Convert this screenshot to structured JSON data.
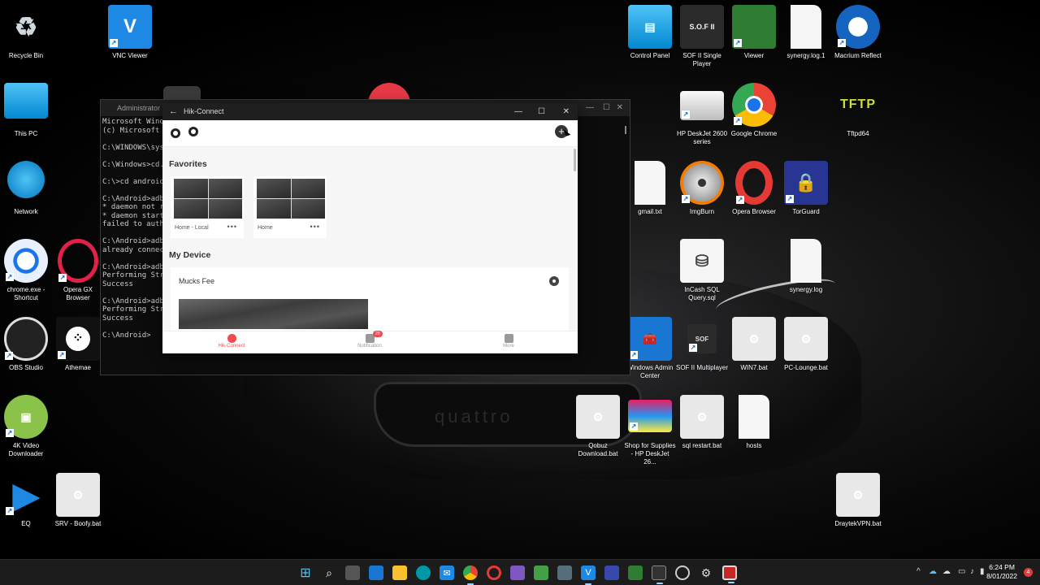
{
  "desktop_icons": [
    {
      "label": "Recycle Bin",
      "icon": "recycle-bin-icon",
      "color": "#cfd8dc"
    },
    {
      "label": "VNC Viewer",
      "icon": "vnc-icon",
      "color": "#1e88e5",
      "text": "V"
    },
    {
      "label": "This PC",
      "icon": "monitor-icon",
      "color": "#29b6f6"
    },
    {
      "label": "Network",
      "icon": "network-icon",
      "color": "#29b6f6"
    },
    {
      "label": "chrome.exe - Shortcut",
      "icon": "chrome-icon",
      "color": "#1a73e8"
    },
    {
      "label": "Opera GX Browser",
      "icon": "opera-gx-icon",
      "color": "#111"
    },
    {
      "label": "OBS Studio",
      "icon": "obs-icon",
      "color": "#222"
    },
    {
      "label": "Athemae",
      "icon": "tidal-icon",
      "color": "#111"
    },
    {
      "label": "4K Video Downloader",
      "icon": "downloader-icon",
      "color": "#8bc34a"
    },
    {
      "label": "EQ",
      "icon": "play-icon",
      "color": "#1e88e5"
    },
    {
      "label": "SRV - Boofy.bat",
      "icon": "batch-file-icon"
    },
    {
      "label": "Control Panel",
      "icon": "control-panel-icon",
      "color": "#29b6f6"
    },
    {
      "label": "SOF II Single Player",
      "icon": "sof-icon",
      "color": "#333",
      "text": "S.O.F II"
    },
    {
      "label": "Viewer",
      "icon": "viewer-icon",
      "color": "#2e7d32"
    },
    {
      "label": "synergy.log.1",
      "icon": "text-file-icon"
    },
    {
      "label": "Macrium Reflect",
      "icon": "macrium-icon",
      "color": "#1565c0"
    },
    {
      "label": "HP DeskJet 2600 series",
      "icon": "printer-icon",
      "color": "#e0e0e0"
    },
    {
      "label": "Google Chrome",
      "icon": "chrome-icon",
      "color": "#1a73e8"
    },
    {
      "label": "Tftpd64",
      "icon": "tftp-icon",
      "color": "#9e9d24",
      "text": "TFTP"
    },
    {
      "label": "gmail.txt",
      "icon": "text-file-icon"
    },
    {
      "label": "ImgBurn",
      "icon": "imgburn-icon",
      "color": "#bdbdbd"
    },
    {
      "label": "Opera Browser",
      "icon": "opera-icon",
      "color": "#e53935"
    },
    {
      "label": "TorGuard",
      "icon": "torguard-icon",
      "color": "#283593"
    },
    {
      "label": "InCash SQL Query.sql",
      "icon": "sql-file-icon",
      "color": "#f5f5f5"
    },
    {
      "label": "synergy.log",
      "icon": "text-file-icon"
    },
    {
      "label": "Windows Admin Center",
      "icon": "admin-center-icon",
      "color": "#1976d2"
    },
    {
      "label": "SOF II Multiplayer",
      "icon": "sof-icon",
      "color": "#333"
    },
    {
      "label": "WIN7.bat",
      "icon": "batch-file-icon"
    },
    {
      "label": "PC-Lounge.bat",
      "icon": "batch-file-icon"
    },
    {
      "label": "Qobuz Download.bat",
      "icon": "batch-file-icon"
    },
    {
      "label": "Shop for Supplies - HP DeskJet 26...",
      "icon": "printer-supplies-icon",
      "color": "#fafafa"
    },
    {
      "label": "sql restart.bat",
      "icon": "batch-file-icon"
    },
    {
      "label": "hosts",
      "icon": "text-file-icon"
    },
    {
      "label": "DraytekVPN.bat",
      "icon": "batch-file-icon"
    }
  ],
  "cmd": {
    "title": "Administrator",
    "lines": "Microsoft Wind\n(c) Microsoft \n\nC:\\WINDOWS\\sys\n\nC:\\Windows>cd.\n\nC:\\>cd android\n\nC:\\Android>adb\n* daemon not r\n* daemon start\nfailed to auth\n\nC:\\Android>adb\nalready connec\n\nC:\\Android>adb\nPerforming Str\nSuccess\n\nC:\\Android>adb\nPerforming Str\nSuccess\n\nC:\\Android>"
  },
  "hik": {
    "title": "Hik-Connect",
    "favorites_title": "Favorites",
    "favorites": [
      {
        "name": "Home - Local",
        "more": "•••"
      },
      {
        "name": "Home",
        "more": "•••"
      }
    ],
    "my_device_title": "My Device",
    "device_name": "Mucks Fee",
    "nav": [
      {
        "label": "Hik-Connect",
        "active": true
      },
      {
        "label": "Notification",
        "badge": "20"
      },
      {
        "label": "More"
      }
    ],
    "accent": "#ee4c52"
  },
  "taskbar": {
    "icons": [
      "windows-start-icon",
      "search-icon",
      "task-view-icon",
      "widgets-icon",
      "file-explorer-icon",
      "edge-icon",
      "mail-icon",
      "chrome-icon",
      "opera-icon",
      "visual-studio-icon",
      "app-icon",
      "vpn-icon",
      "vnc-icon",
      "teams-icon",
      "spreadsheet-icon",
      "terminal-icon",
      "obs-icon",
      "settings-icon",
      "hik-connect-icon"
    ],
    "time": "6:24 PM",
    "date": "8/01/2022",
    "notifications": "4"
  }
}
